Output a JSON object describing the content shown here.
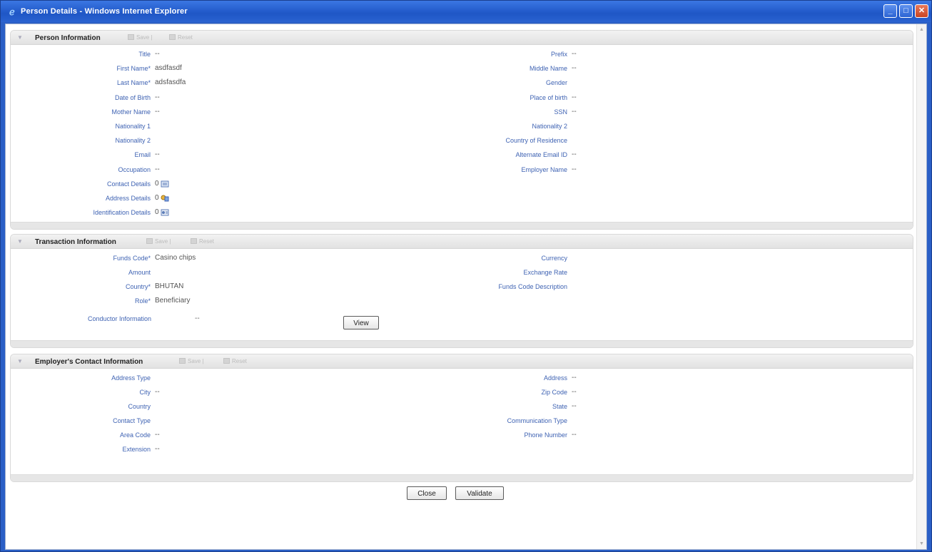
{
  "window": {
    "title": "Person Details - Windows Internet Explorer",
    "min_label": "_",
    "max_label": "□",
    "close_label": "✕"
  },
  "header_actions": {
    "save": "Save |",
    "reset": "Reset"
  },
  "person": {
    "title": "Person Information",
    "left": [
      {
        "label": "Title",
        "value": "--"
      },
      {
        "label": "First Name*",
        "value": "asdfasdf"
      },
      {
        "label": "Last Name*",
        "value": "adsfasdfa"
      },
      {
        "label": "Date of Birth",
        "value": "--"
      },
      {
        "label": "Mother Name",
        "value": "--"
      },
      {
        "label": "Nationality 1",
        "value": ""
      },
      {
        "label": "Nationality 2",
        "value": ""
      },
      {
        "label": "Email",
        "value": "--"
      },
      {
        "label": "Occupation",
        "value": "--"
      },
      {
        "label": "Contact Details",
        "value": "0"
      },
      {
        "label": "Address Details",
        "value": "0"
      },
      {
        "label": "Identification Details",
        "value": "0"
      }
    ],
    "right": [
      {
        "label": "Prefix",
        "value": "--"
      },
      {
        "label": "Middle Name",
        "value": "--"
      },
      {
        "label": "Gender",
        "value": ""
      },
      {
        "label": "Place of birth",
        "value": "--"
      },
      {
        "label": "SSN",
        "value": "--"
      },
      {
        "label": "Nationality 2",
        "value": ""
      },
      {
        "label": "Country of Residence",
        "value": ""
      },
      {
        "label": "Alternate Email ID",
        "value": "--"
      },
      {
        "label": "Employer Name",
        "value": "--"
      }
    ]
  },
  "transaction": {
    "title": "Transaction Information",
    "left": [
      {
        "label": "Funds Code*",
        "value": "Casino chips"
      },
      {
        "label": "Amount",
        "value": ""
      },
      {
        "label": "Country*",
        "value": "BHUTAN"
      },
      {
        "label": "Role*",
        "value": "Beneficiary"
      }
    ],
    "conductor_label": "Conductor Information",
    "conductor_value": "--",
    "view_button": "View",
    "right": [
      {
        "label": "Currency",
        "value": ""
      },
      {
        "label": "Exchange Rate",
        "value": ""
      },
      {
        "label": "Funds Code Description",
        "value": ""
      }
    ]
  },
  "employer": {
    "title": "Employer's Contact Information",
    "left": [
      {
        "label": "Address Type",
        "value": ""
      },
      {
        "label": "City",
        "value": "--"
      },
      {
        "label": "Country",
        "value": ""
      },
      {
        "label": "Contact Type",
        "value": ""
      },
      {
        "label": "Area Code",
        "value": "--"
      },
      {
        "label": "Extension",
        "value": "--"
      }
    ],
    "right": [
      {
        "label": "Address",
        "value": "--"
      },
      {
        "label": "Zip Code",
        "value": "--"
      },
      {
        "label": "State",
        "value": "--"
      },
      {
        "label": "Communication Type",
        "value": ""
      },
      {
        "label": "Phone Number",
        "value": "--"
      }
    ]
  },
  "footer": {
    "close": "Close",
    "validate": "Validate"
  },
  "colors": {
    "title_bar": "#2a5fc6",
    "label": "#3f63b3",
    "panel_header": "#e6e6e6"
  },
  "icons": [
    "ie-logo-icon",
    "minimize-icon",
    "maximize-icon",
    "close-icon",
    "collapse-arrow-icon",
    "save-icon",
    "reset-icon",
    "contact-details-icon",
    "address-details-icon",
    "identification-details-icon"
  ]
}
